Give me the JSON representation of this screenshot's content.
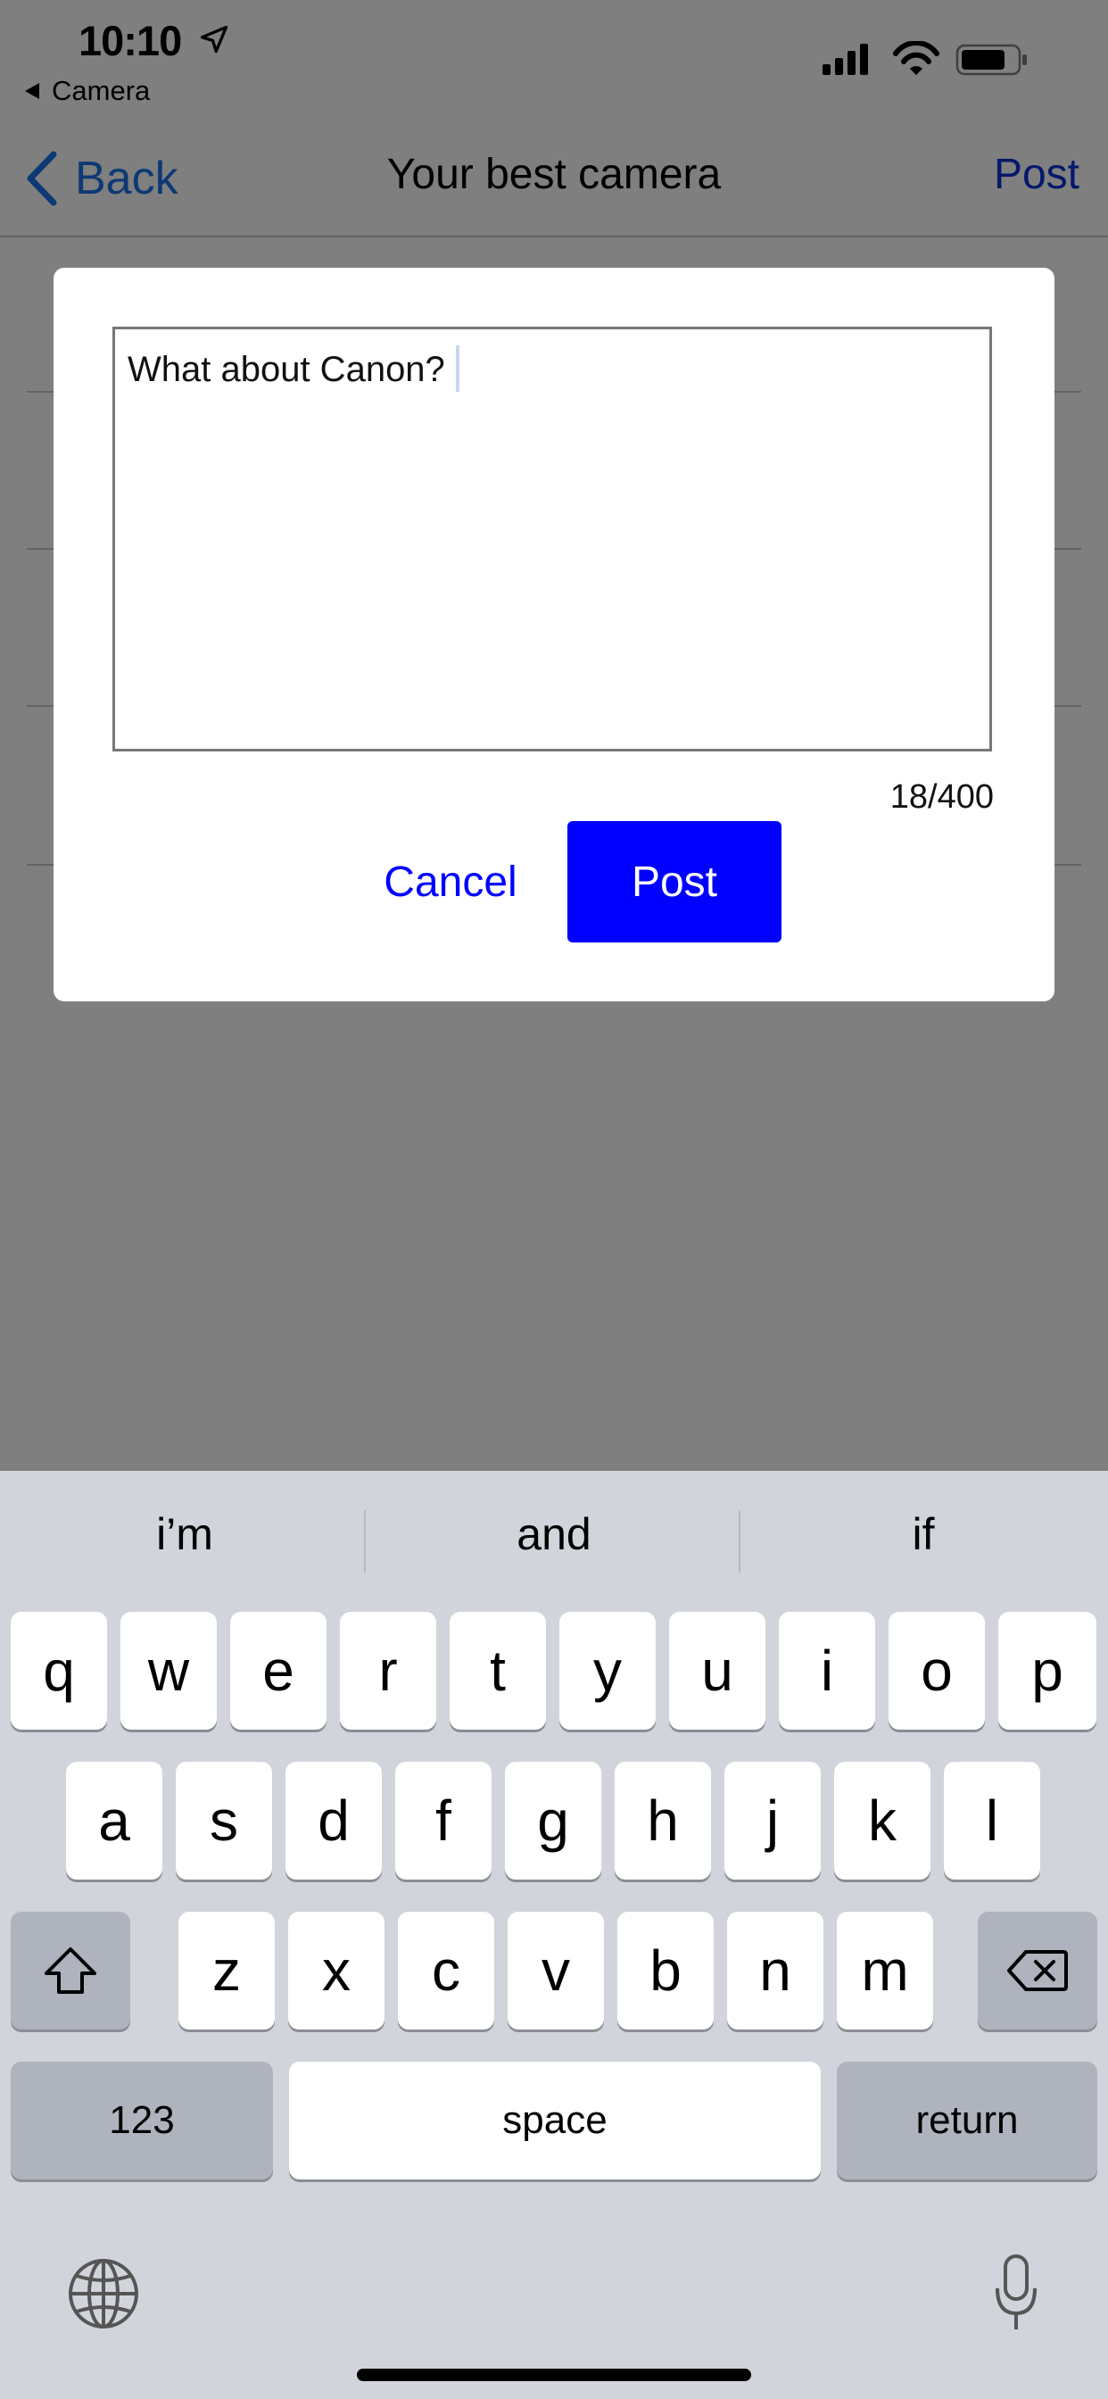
{
  "status_bar": {
    "time": "10:10",
    "back_app": "Camera"
  },
  "nav": {
    "back_label": "Back",
    "title": "Your best camera",
    "post_label": "Post"
  },
  "dialog": {
    "text_value": "What about Canon?",
    "char_count": "18/400",
    "cancel_label": "Cancel",
    "post_label": "Post"
  },
  "keyboard": {
    "suggestions": [
      "i’m",
      "and",
      "if"
    ],
    "row1": [
      "q",
      "w",
      "e",
      "r",
      "t",
      "y",
      "u",
      "i",
      "o",
      "p"
    ],
    "row2": [
      "a",
      "s",
      "d",
      "f",
      "g",
      "h",
      "j",
      "k",
      "l"
    ],
    "row3": [
      "z",
      "x",
      "c",
      "v",
      "b",
      "n",
      "m"
    ],
    "numbers_label": "123",
    "space_label": "space",
    "return_label": "return"
  },
  "colors": {
    "accent_blue": "#0000ff",
    "nav_blue": "#1a73e8",
    "overlay": "rgba(0,0,0,0.5)",
    "keyboard_bg": "#d1d4db"
  }
}
